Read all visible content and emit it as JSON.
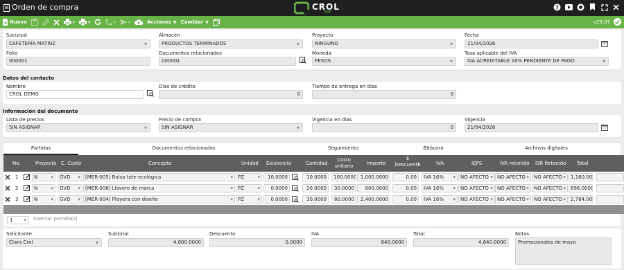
{
  "window": {
    "title": "Orden de compra",
    "logo_main": "CROL",
    "logo_sub": "ERP",
    "version": "v29.07"
  },
  "toolbar": {
    "new_label": "Nuevo",
    "actions_label": "Acciones",
    "change_label": "Cambiar"
  },
  "header": {
    "sucursal": {
      "label": "Sucursal",
      "value": "CAFETERÍA MATRIZ"
    },
    "almacen": {
      "label": "Almacén",
      "value": "PRODUCTOS TERMINADOS"
    },
    "proyecto": {
      "label": "Proyecto",
      "value": "NINGUNO"
    },
    "fecha": {
      "label": "Fecha",
      "value": "21/04/2026"
    },
    "folio": {
      "label": "Folio",
      "value": "000001"
    },
    "docs": {
      "label": "Documentos relacionados",
      "value": "000001"
    },
    "moneda": {
      "label": "Moneda",
      "value": "PESOS"
    },
    "tasa": {
      "label": "Tasa aplicable del IVA",
      "value": "IVA ACREDITABLE 16% PENDIENTE DE PAGO"
    }
  },
  "contact": {
    "section": "Datos del contacto",
    "nombre": {
      "label": "Nombre",
      "value": "CROL DEMO"
    },
    "dias": {
      "label": "Días de crédito",
      "value": "0"
    },
    "entrega": {
      "label": "Tiempo de entrega en días",
      "value": "0"
    }
  },
  "docinfo": {
    "section": "Información del documento",
    "lista": {
      "label": "Lista de precios",
      "value": "SIN ASIGNAR"
    },
    "precio": {
      "label": "Precio de compra",
      "value": "SIN ASIGNAR"
    },
    "vig_dias": {
      "label": "Vigencia en días",
      "value": "0"
    },
    "vigencia": {
      "label": "Vigencia",
      "value": "21/04/2026"
    }
  },
  "tabs": [
    "Partidas",
    "Documentos relacionados",
    "Seguimiento",
    "Bitácora",
    "Archivos digitales"
  ],
  "grid": {
    "headers": {
      "no": "No.",
      "proyecto": "Proyecto",
      "costo": "C. Costo",
      "concepto": "Concepto",
      "unidad": "Unidad",
      "existencia": "Existencia",
      "cantidad": "Cantidad",
      "unitario": "Costo unitario",
      "importe": "Importe",
      "descuento": "$ Descuento",
      "desc_sup": "1",
      "iva": "IVA",
      "ieps": "IEPS",
      "iva_ret": "IVA retenido",
      "isr_ret": "ISR Retenido",
      "total": "Total"
    },
    "rows": [
      {
        "no": "1",
        "proyecto": "N",
        "costo": "GVD",
        "concepto": "[MER-005] Bolsa tote ecológica",
        "unidad": "PZ",
        "existencia": "10.0000",
        "cantidad": "10.0000",
        "unitario": "100.0000",
        "importe": "1,000.0000",
        "descuento": "0.00",
        "iva": "IVA 16%",
        "ieps": "NO AFECTO",
        "iva_ret": "NO AFECTO",
        "isr_ret": "NO AFECTO",
        "total": "1,160.00"
      },
      {
        "no": "2",
        "proyecto": "N",
        "costo": "GVD",
        "concepto": "[MER-006] Llavero de marca",
        "unidad": "PZ",
        "existencia": "0.0000",
        "cantidad": "20.0000",
        "unitario": "30.0000",
        "importe": "600.0000",
        "descuento": "0.00",
        "iva": "IVA 16%",
        "ieps": "NO AFECTO",
        "iva_ret": "NO AFECTO",
        "isr_ret": "NO AFECTO",
        "total": "696.0000"
      },
      {
        "no": "3",
        "proyecto": "N",
        "costo": "GVD",
        "concepto": "[MER-004] Playera con diseño",
        "unidad": "PZ",
        "existencia": "0.0000",
        "cantidad": "30.0000",
        "unitario": "80.0000",
        "importe": "2,400.0000",
        "descuento": "0.00",
        "iva": "IVA 16%",
        "ieps": "NO AFECTO",
        "iva_ret": "NO AFECTO",
        "isr_ret": "NO AFECTO",
        "total": "2,784.00"
      }
    ]
  },
  "pager": {
    "page": "1",
    "add_row": "Insertar partida(s)"
  },
  "footer": {
    "solicitante": {
      "label": "Solicitante",
      "value": "Clara Crol"
    },
    "subtotal": {
      "label": "Subtotal",
      "value": "4,000.0000"
    },
    "descuento": {
      "label": "Descuento",
      "value": "0.0000"
    },
    "iva": {
      "label": "IVA",
      "value": "640.0000"
    },
    "total": {
      "label": "Total",
      "value": "4,640.0000"
    },
    "notas": {
      "label": "Notas",
      "value": "Promocionales de mayo"
    }
  },
  "colors": {
    "toolbar": "#67b346",
    "titlebar": "#1f1f1f",
    "grid_header": "#5f5f5f"
  }
}
